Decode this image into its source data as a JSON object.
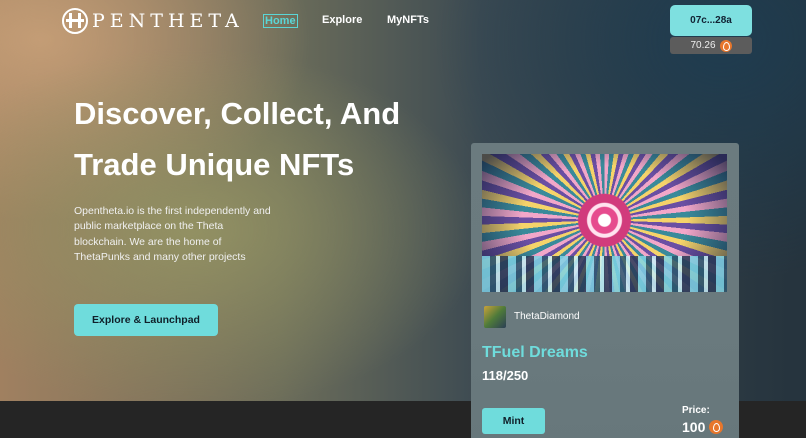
{
  "header": {
    "logo_text": "PENTHETA",
    "nav": {
      "home": "Home",
      "explore": "Explore",
      "mynfts": "MyNFTs"
    },
    "wallet_address": "07c...28a",
    "balance": "70.26",
    "balance_icon": "tfuel-icon"
  },
  "hero": {
    "headline_line1": "Discover, Collect, And",
    "headline_line2": "Trade Unique NFTs",
    "description": "Opentheta.io is the first independently and public marketplace on the Theta blockchain. We are the home of ThetaPunks and many other projects",
    "cta_label": "Explore & Launchpad"
  },
  "featured_nft": {
    "creator": "ThetaDiamond",
    "title": "TFuel Dreams",
    "edition": "118/250",
    "mint_label": "Mint",
    "price_label": "Price:",
    "price_value": "100",
    "price_icon": "tfuel-icon"
  },
  "colors": {
    "accent": "#6fdcdc",
    "footer": "#252525"
  }
}
